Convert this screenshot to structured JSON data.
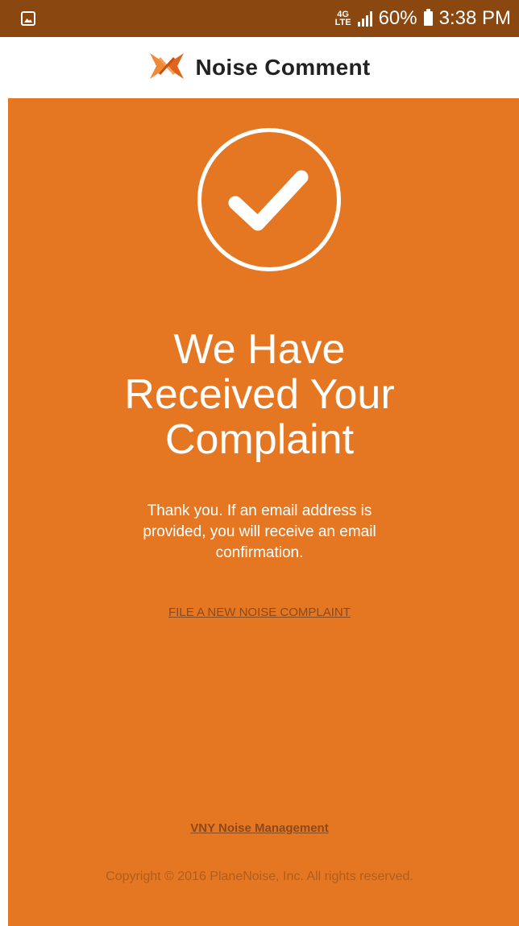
{
  "status_bar": {
    "battery": "60%",
    "time": "3:38 PM",
    "network": "4G LTE",
    "icons": [
      "gallery-icon",
      "network-icon",
      "signal-icon",
      "battery-icon"
    ]
  },
  "header": {
    "title": "Noise Comment",
    "logo_icon": "noise-logo-icon"
  },
  "main": {
    "status_icon": "check-circle-icon",
    "headline_lines": [
      "We Have",
      "Received Your",
      "Complaint"
    ],
    "message_lines": [
      "Thank you. If an email address is",
      "provided, you will receive an email",
      "confirmation."
    ],
    "new_complaint_link": "FILE A NEW NOISE COMPLAINT",
    "footer_link": "VNY Noise Management",
    "copyright": "Copyright © 2016 PlaneNoise, Inc. All rights reserved."
  },
  "colors": {
    "status_bar": "#8a4710",
    "background_orange": "#e57722",
    "link": "#8a4a1c",
    "copyright": "#b05d1c"
  }
}
